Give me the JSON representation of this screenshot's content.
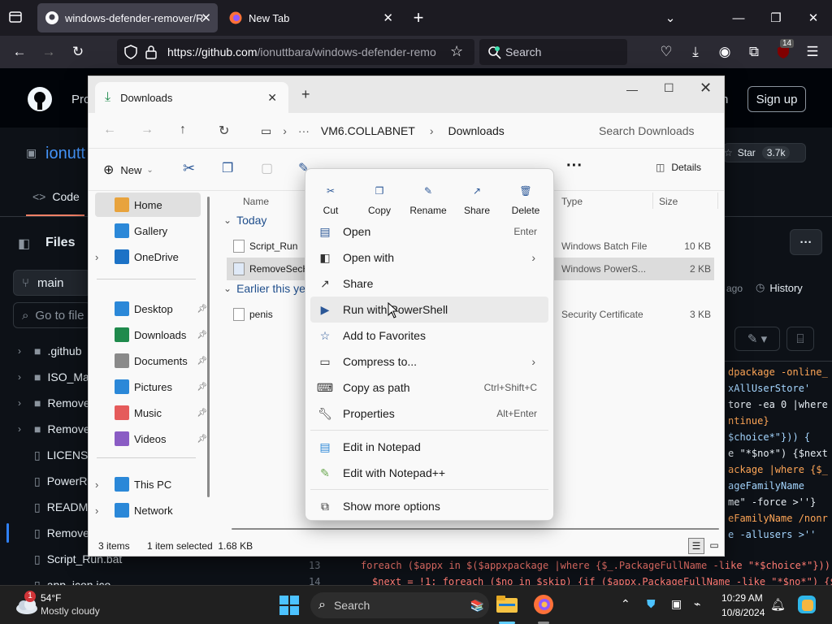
{
  "browser": {
    "tabs": [
      {
        "title": "windows-defender-remover/Re",
        "active": true
      },
      {
        "title": "New Tab",
        "active": false
      }
    ],
    "url_main": "https://github.com",
    "url_rest": "/ionuttbara/windows-defender-remo",
    "search_placeholder": "Search",
    "extension_badge": "14"
  },
  "github": {
    "header_partial": "Pro",
    "sign_up": "Sign up",
    "header_right_partial": "n",
    "repo_partial": "ionutt",
    "star_label": "Star",
    "star_count": "3.7k",
    "code_tab": "Code",
    "files_title": "Files",
    "branch": "main",
    "goto_file": "Go to file",
    "history_ago": "ago",
    "history_label": "History",
    "tree": [
      {
        "name": ".github",
        "kind": "folder"
      },
      {
        "name": "ISO_Ma",
        "kind": "folder"
      },
      {
        "name": "Remove",
        "kind": "folder"
      },
      {
        "name": "Remove",
        "kind": "folder"
      },
      {
        "name": "LICENS",
        "kind": "file"
      },
      {
        "name": "PowerR",
        "kind": "file"
      },
      {
        "name": "READM",
        "kind": "file"
      },
      {
        "name": "Remove",
        "kind": "file"
      },
      {
        "name": "Script_Run.bat",
        "kind": "file"
      },
      {
        "name": "app_icon.ico",
        "kind": "file"
      }
    ],
    "code_right": [
      "dpackage -online_",
      "xAllUserStore'",
      "tore -ea 0 |where",
      "ntinue}",
      "$choice*\"})) {",
      "e \"*$no*\") {$next",
      "ackage |where {$_",
      "ageFamilyName",
      "me\" -force >''} ",
      "eFamilyName /nonr",
      "e -allusers >''"
    ],
    "code_bottom": [
      {
        "num": "13",
        "text": "foreach ($appx in $($appxpackage |where {$_.PackageFullName -like \"*$choice*\"}))"
      },
      {
        "num": "14",
        "text": "$next = !1; foreach ($no in $skip) {if ($appx.PackageFullName -like \"*$no*\") {$"
      }
    ]
  },
  "explorer": {
    "tab_title": "Downloads",
    "breadcrumb": [
      "VM6.COLLABNET",
      "Downloads"
    ],
    "search_placeholder": "Search Downloads",
    "new_label": "New",
    "details_label": "Details",
    "nav": {
      "top": [
        {
          "label": "Home",
          "icon": "home-icon",
          "selected": true
        },
        {
          "label": "Gallery",
          "icon": "gallery-icon"
        },
        {
          "label": "OneDrive",
          "icon": "onedrive-icon"
        }
      ],
      "quick": [
        {
          "label": "Desktop",
          "icon": "desktop-icon"
        },
        {
          "label": "Downloads",
          "icon": "downloads-icon"
        },
        {
          "label": "Documents",
          "icon": "documents-icon"
        },
        {
          "label": "Pictures",
          "icon": "pictures-icon"
        },
        {
          "label": "Music",
          "icon": "music-icon"
        },
        {
          "label": "Videos",
          "icon": "videos-icon"
        }
      ],
      "bottom": [
        {
          "label": "This PC",
          "icon": "this-pc-icon"
        },
        {
          "label": "Network",
          "icon": "network-icon"
        }
      ]
    },
    "columns": {
      "name": "Name",
      "type": "Type",
      "size": "Size"
    },
    "groups": [
      {
        "label": "Today",
        "files": [
          {
            "name": "Script_Run",
            "type": "Windows Batch File",
            "size": "10 KB",
            "selected": false
          },
          {
            "name": "RemoveSecH",
            "type": "Windows PowerS...",
            "size": "2 KB",
            "selected": true
          }
        ]
      },
      {
        "label": "Earlier this ye",
        "files": [
          {
            "name": "penis",
            "type": "Security Certificate",
            "size": "3 KB",
            "selected": false
          }
        ]
      }
    ],
    "status": {
      "items": "3 items",
      "selected": "1 item selected  1.68 KB"
    }
  },
  "context_menu": {
    "quick_actions": [
      "Cut",
      "Copy",
      "Rename",
      "Share",
      "Delete"
    ],
    "items": [
      {
        "label": "Open",
        "shortcut": "Enter",
        "icon": "open-icon"
      },
      {
        "label": "Open with",
        "submenu": true,
        "icon": "open-with-icon"
      },
      {
        "label": "Share",
        "icon": "share-icon"
      },
      {
        "label": "Run with PowerShell",
        "icon": "powershell-icon",
        "hover": true
      },
      {
        "label": "Add to Favorites",
        "icon": "star-icon"
      },
      {
        "label": "Compress to...",
        "submenu": true,
        "icon": "zip-icon"
      },
      {
        "label": "Copy as path",
        "shortcut": "Ctrl+Shift+C",
        "icon": "copy-path-icon"
      },
      {
        "label": "Properties",
        "shortcut": "Alt+Enter",
        "icon": "properties-icon"
      }
    ],
    "items2": [
      {
        "label": "Edit in Notepad",
        "icon": "notepad-icon"
      },
      {
        "label": "Edit with Notepad++",
        "icon": "notepadpp-icon"
      }
    ],
    "items3": [
      {
        "label": "Show more options",
        "icon": "more-options-icon"
      }
    ]
  },
  "taskbar": {
    "weather_temp": "54°F",
    "weather_desc": "Mostly cloudy",
    "weather_badge": "1",
    "search_label": "Search",
    "time": "10:29 AM",
    "date": "10/8/2024"
  }
}
